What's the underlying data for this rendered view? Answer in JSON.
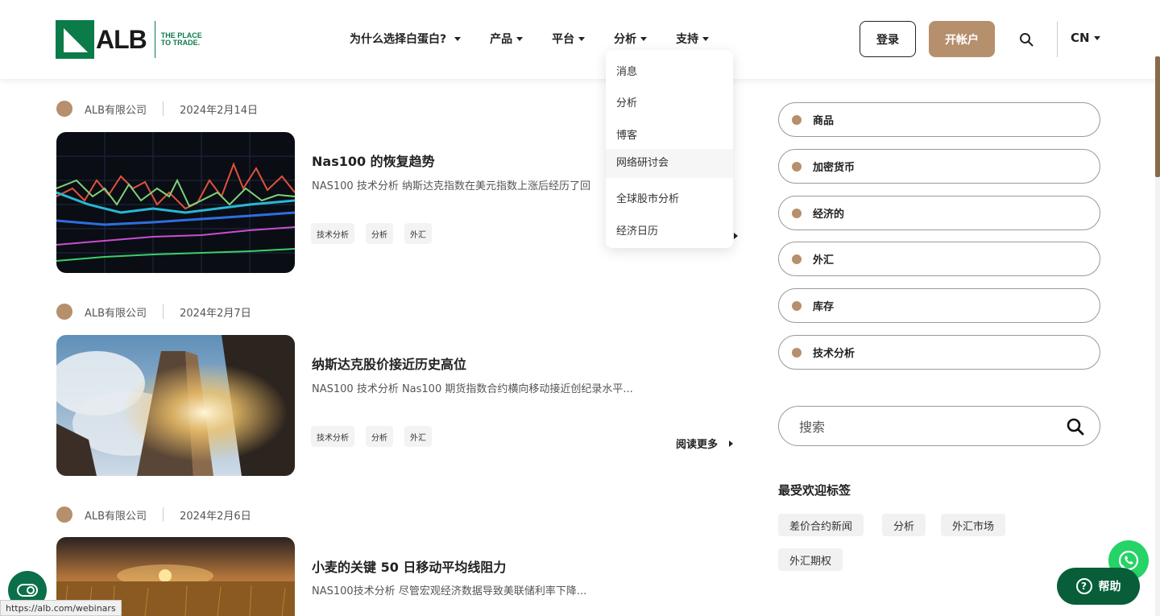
{
  "header": {
    "logo_text": "ALB",
    "tagline": "THE PLACE TO TRADE.",
    "nav": [
      {
        "label": "为什么选择白蛋白?"
      },
      {
        "label": "产品"
      },
      {
        "label": "平台"
      },
      {
        "label": "分析"
      },
      {
        "label": "支持"
      }
    ],
    "login_label": "登录",
    "open_account_label": "开帐户",
    "language": "CN"
  },
  "dropdown": {
    "items": [
      "消息",
      "分析",
      "博客",
      "网络研讨会",
      "全球股市分析",
      "经济日历"
    ]
  },
  "articles": [
    {
      "author": "ALB有限公司",
      "date": "2024年2月14日",
      "title": "Nas100 的恢复趋势",
      "excerpt": "NAS100 技术分析 纳斯达克指数在美元指数上涨后经历了回",
      "tags": [
        "技术分析",
        "分析",
        "外汇"
      ],
      "read_more": "阅读更多"
    },
    {
      "author": "ALB有限公司",
      "date": "2024年2月7日",
      "title": "纳斯达克股价接近历史高位",
      "excerpt": "NAS100 技术分析 Nas100 期货指数合约横向移动接近创纪录水平...",
      "tags": [
        "技术分析",
        "分析",
        "外汇"
      ],
      "read_more": "阅读更多"
    },
    {
      "author": "ALB有限公司",
      "date": "2024年2月6日",
      "title": "小麦的关键 50 日移动平均线阻力",
      "excerpt": "NAS100技术分析 尽管宏观经济数据导致美联储利率下降..."
    }
  ],
  "sidebar": {
    "categories": [
      "商品",
      "加密货币",
      "经济的",
      "外汇",
      "库存",
      "技术分析"
    ],
    "search_placeholder": "搜索",
    "popular_title": "最受欢迎标签",
    "popular_tags": [
      "差价合约新闻",
      "分析",
      "外汇市场",
      "外汇期权"
    ]
  },
  "floating": {
    "help_label": "帮助",
    "help_glyph": "?",
    "status_url": "https://alb.com/webinars"
  },
  "colors": {
    "brand_green": "#0b7b4a",
    "accent_tan": "#b68f6c",
    "whatsapp": "#25d366",
    "help_bg": "#075e39"
  }
}
